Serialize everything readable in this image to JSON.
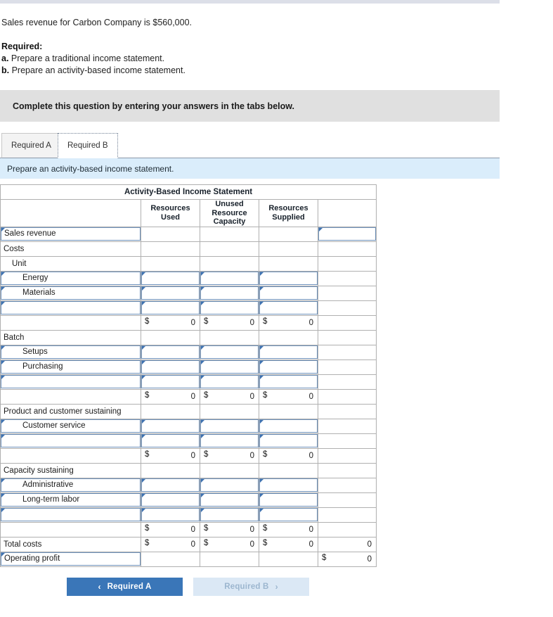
{
  "prompt": {
    "intro": "Sales revenue for Carbon Company is $560,000.",
    "required_heading": "Required:",
    "item_a_marker": "a.",
    "item_a": "Prepare a traditional income statement.",
    "item_b_marker": "b.",
    "item_b": "Prepare an activity-based income statement."
  },
  "instruction": {
    "text": "Complete this question by entering your answers in the tabs below."
  },
  "tabs": [
    {
      "label": "Required A",
      "active": false
    },
    {
      "label": "Required B",
      "active": true
    }
  ],
  "subprompt": {
    "text": "Prepare an activity-based income statement."
  },
  "table": {
    "title": "Activity-Based Income Statement",
    "columns": [
      "",
      "Resources Used",
      "Unused Resource Capacity",
      "Resources Supplied",
      ""
    ],
    "column_lines": [
      [
        "Resources",
        "Used"
      ],
      [
        "Unused",
        "Resource",
        "Capacity"
      ],
      [
        "Resources",
        "Supplied"
      ]
    ],
    "rows": [
      {
        "kind": "input-label",
        "label": "Sales revenue",
        "indent": 0,
        "cells": [
          "",
          "",
          ""
        ],
        "last": "input"
      },
      {
        "kind": "text",
        "label": "Costs",
        "indent": 0,
        "cells": [
          "",
          "",
          ""
        ],
        "last": ""
      },
      {
        "kind": "text",
        "label": "Unit",
        "indent": 1,
        "cells": [
          "",
          "",
          ""
        ],
        "last": ""
      },
      {
        "kind": "input-label",
        "label": "Energy",
        "indent": 2,
        "cells": [
          "input",
          "input",
          "input"
        ],
        "last": ""
      },
      {
        "kind": "input-label",
        "label": "Materials",
        "indent": 2,
        "cells": [
          "input",
          "input",
          "input"
        ],
        "last": ""
      },
      {
        "kind": "input-label",
        "label": "",
        "indent": 2,
        "cells": [
          "input",
          "input",
          "input"
        ],
        "last": ""
      },
      {
        "kind": "subtotal",
        "label": "",
        "indent": 0,
        "cells": [
          "0",
          "0",
          "0"
        ],
        "last": ""
      },
      {
        "kind": "text",
        "label": "Batch",
        "indent": 0,
        "cells": [
          "",
          "",
          ""
        ],
        "last": ""
      },
      {
        "kind": "input-label",
        "label": "Setups",
        "indent": 2,
        "cells": [
          "input",
          "input",
          "input"
        ],
        "last": ""
      },
      {
        "kind": "input-label",
        "label": "Purchasing",
        "indent": 2,
        "cells": [
          "input",
          "input",
          "input"
        ],
        "last": ""
      },
      {
        "kind": "input-label",
        "label": "",
        "indent": 2,
        "cells": [
          "input",
          "input",
          "input"
        ],
        "last": ""
      },
      {
        "kind": "subtotal",
        "label": "",
        "indent": 0,
        "cells": [
          "0",
          "0",
          "0"
        ],
        "last": ""
      },
      {
        "kind": "text",
        "label": "Product and customer sustaining",
        "indent": 0,
        "cells": [
          "",
          "",
          ""
        ],
        "last": ""
      },
      {
        "kind": "input-label",
        "label": "Customer service",
        "indent": 2,
        "cells": [
          "input",
          "input",
          "input"
        ],
        "last": ""
      },
      {
        "kind": "input-label",
        "label": "",
        "indent": 2,
        "cells": [
          "input",
          "input",
          "input"
        ],
        "last": ""
      },
      {
        "kind": "subtotal",
        "label": "",
        "indent": 0,
        "cells": [
          "0",
          "0",
          "0"
        ],
        "last": ""
      },
      {
        "kind": "text",
        "label": "Capacity sustaining",
        "indent": 0,
        "cells": [
          "",
          "",
          ""
        ],
        "last": ""
      },
      {
        "kind": "input-label",
        "label": "Administrative",
        "indent": 2,
        "cells": [
          "input",
          "input",
          "input"
        ],
        "last": ""
      },
      {
        "kind": "input-label",
        "label": "Long-term labor",
        "indent": 2,
        "cells": [
          "input",
          "input",
          "input"
        ],
        "last": ""
      },
      {
        "kind": "input-label",
        "label": "",
        "indent": 2,
        "cells": [
          "input",
          "input",
          "input"
        ],
        "last": ""
      },
      {
        "kind": "subtotal",
        "label": "",
        "indent": 0,
        "cells": [
          "0",
          "0",
          "0"
        ],
        "last": ""
      },
      {
        "kind": "total",
        "label": "Total costs",
        "indent": 0,
        "cells": [
          "0",
          "0",
          "0"
        ],
        "last": "0"
      },
      {
        "kind": "profit",
        "label": "Operating profit",
        "indent": 0,
        "cells": [
          "",
          "",
          ""
        ],
        "last": "0"
      }
    ],
    "currency_symbol": "$"
  },
  "buttons": {
    "prev": {
      "label": "Required A",
      "icon": "chevron-left-icon",
      "glyph": "‹"
    },
    "next": {
      "label": "Required B",
      "icon": "chevron-right-icon",
      "glyph": "›"
    }
  },
  "colors": {
    "header_blue": "#7aafe6",
    "instruction_gray": "#e0e0e0",
    "subprompt_blue": "#daedfb",
    "primary_button": "#3a76b8",
    "ghost_button": "#dbe8f5",
    "input_border": "#6f92bb"
  }
}
